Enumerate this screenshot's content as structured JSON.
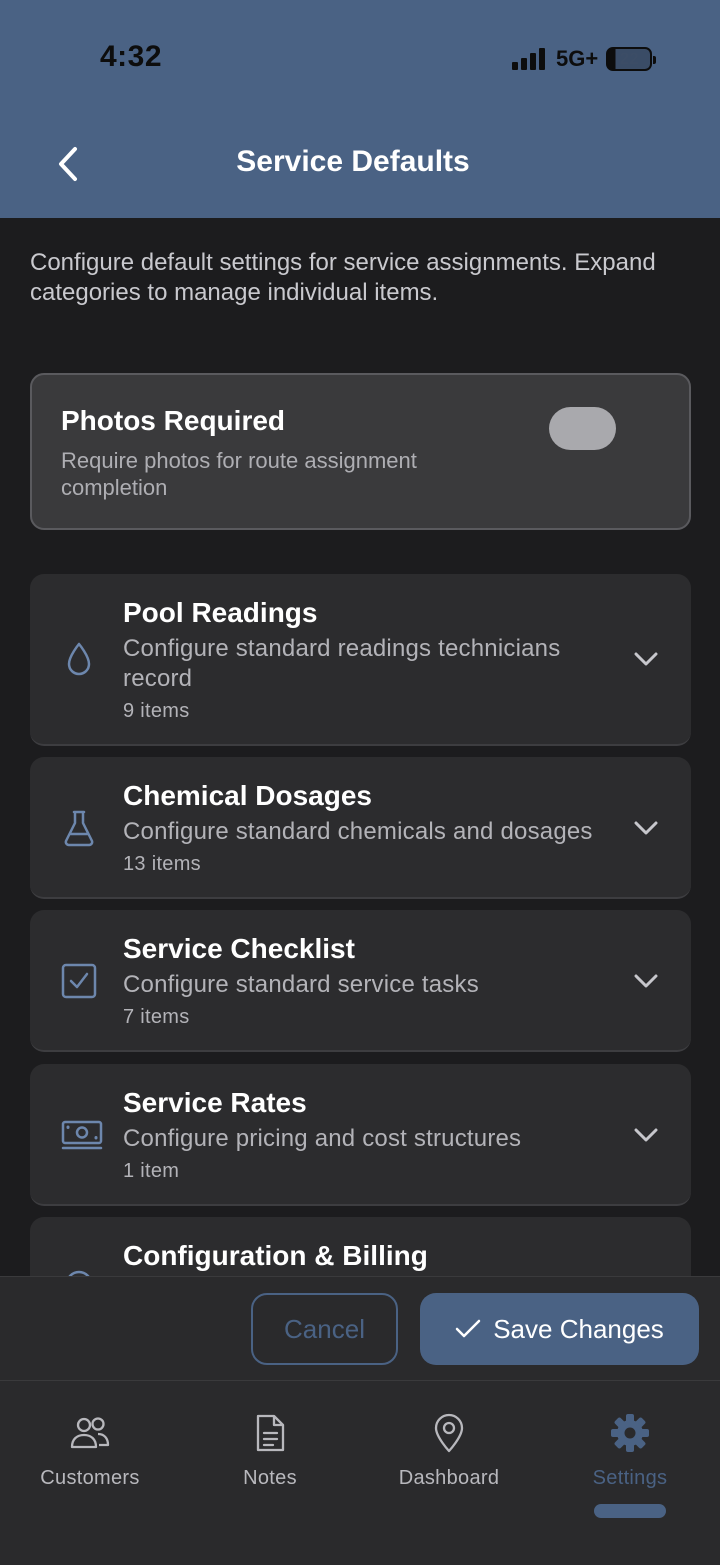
{
  "status_bar": {
    "time": "4:32",
    "network": "5G+",
    "battery": "22"
  },
  "header": {
    "title": "Service Defaults",
    "back_icon": "chevron-left-icon"
  },
  "description": "Configure default settings for service assignments. Expand categories to manage individual items.",
  "photos_required": {
    "title": "Photos Required",
    "subtitle": "Require photos for route assignment completion",
    "enabled": false
  },
  "categories": [
    {
      "title": "Pool Readings",
      "description": "Configure standard readings technicians record",
      "count": "9 items",
      "icon": "water-drop-icon"
    },
    {
      "title": "Chemical Dosages",
      "description": "Configure standard chemicals and dosages",
      "count": "13 items",
      "icon": "flask-icon"
    },
    {
      "title": "Service Checklist",
      "description": "Configure standard service tasks",
      "count": "7 items",
      "icon": "checkbox-icon"
    },
    {
      "title": "Service Rates",
      "description": "Configure pricing and cost structures",
      "count": "1 item",
      "icon": "money-icon"
    },
    {
      "title": "Configuration & Billing",
      "icon": "gear-icon"
    }
  ],
  "actions": {
    "cancel_label": "Cancel",
    "save_label": "Save Changes"
  },
  "tabs": [
    {
      "label": "Customers",
      "icon": "users-icon"
    },
    {
      "label": "Notes",
      "icon": "document-icon"
    },
    {
      "label": "Dashboard",
      "icon": "map-pin-icon"
    },
    {
      "label": "Settings",
      "icon": "gear-icon",
      "active": true
    }
  ],
  "colors": {
    "accent": "#4a6284",
    "background": "#1c1c1e",
    "card": "#2c2c2e"
  }
}
